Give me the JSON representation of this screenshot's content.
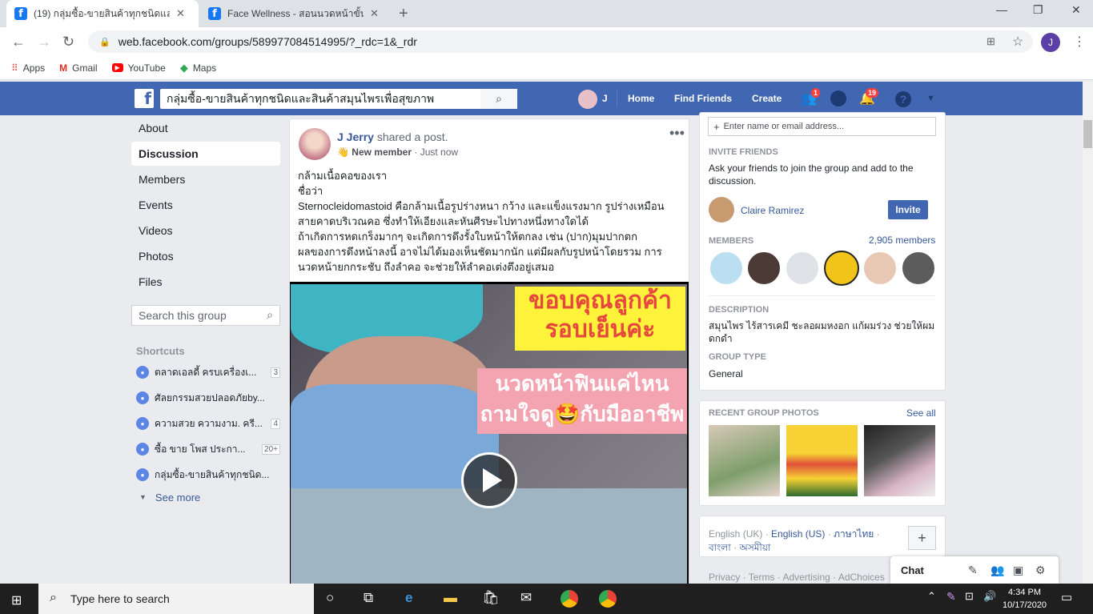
{
  "browser": {
    "tabs": [
      {
        "title": "(19) กลุ่มซื้อ-ขายสินค้าทุกชนิดและสิน"
      },
      {
        "title": "Face Wellness - สอนนวดหน้าขั้นสูงด้"
      }
    ],
    "url": "web.facebook.com/groups/589977084514995/?_rdc=1&_rdr",
    "profile_initial": "J",
    "bookmarks": [
      {
        "label": "Apps",
        "icon": "apps-grid-icon"
      },
      {
        "label": "Gmail",
        "icon": "gmail-icon"
      },
      {
        "label": "YouTube",
        "icon": "youtube-icon"
      },
      {
        "label": "Maps",
        "icon": "maps-icon"
      }
    ]
  },
  "fb": {
    "search_value": "กลุ่มซื้อ-ขายสินค้าทุกชนิดและสินค้าสมุนไพรเพื่อสุขภาพ",
    "profile_name": "J",
    "nav": {
      "home": "Home",
      "find_friends": "Find Friends",
      "create": "Create"
    },
    "badges": {
      "friends": "1",
      "notifications": "19"
    }
  },
  "left_nav": {
    "items": [
      "About",
      "Discussion",
      "Members",
      "Events",
      "Videos",
      "Photos",
      "Files"
    ],
    "selected": "Discussion",
    "search_placeholder": "Search this group",
    "shortcuts_title": "Shortcuts",
    "shortcuts": [
      {
        "name": "ตลาดเอลดี้ ครบเครื่องเ...",
        "count": "3"
      },
      {
        "name": "ศัลยกรรมสวยปลอดภัยby...",
        "count": ""
      },
      {
        "name": "ความสวย ความงาม. ครี...",
        "count": "4"
      },
      {
        "name": "ซื้อ ขาย โพส ประกา...",
        "count": "20+"
      },
      {
        "name": "กลุ่มซื้อ-ขายสินค้าทุกชนิด...",
        "count": ""
      }
    ],
    "see_more": "See more"
  },
  "post": {
    "author": "J Jerry",
    "action": "shared a post.",
    "badge": "New member",
    "time": "Just now",
    "text_lines": [
      "กล้ามเนื้อคอของเรา",
      "ชื่อว่า",
      "Sternocleidomastoid คือกล้ามเนื้อรูปร่างหนา กว้าง และแข็งแรงมาก รูปร่างเหมือน",
      "สายคาดบริเวณคอ ซึ่งทำให้เอียงและหันศีรษะไปทางหนึ่งทางใดได้",
      "ถ้าเกิดการหดเกร็งมากๆ จะเกิดการดึงรั้งใบหน้าให้ตกลง เช่น (ปาก)มุมปากตก",
      "ผลของการดึงหน้าลงนี้ อาจไม่ได้มองเห็นชัดมากนัก แต่มีผลกับรูปหน้าโดยรวม การ",
      "นวดหน้ายกกระชับ ถึงลำคอ จะช่วยให้ลำคอเต่งตึงอยู่เสมอ"
    ],
    "video_caption_1": "ขอบคุณลูกค้า รอบเย็นค่ะ",
    "video_caption_2": "นวดหน้าฟินแค่ไหน ถามใจดู🤩กับมืออาชีพ"
  },
  "right": {
    "add_member_placeholder": "Enter name or email address...",
    "invite_title": "INVITE FRIENDS",
    "invite_text": "Ask your friends to join the group and add to the discussion.",
    "suggested_friend": "Claire Ramirez",
    "invite_button": "Invite",
    "members_title": "MEMBERS",
    "members_count": "2,905 members",
    "description_title": "DESCRIPTION",
    "description": "สมุนไพร ไร้สารเคมี ชะลอผมหงอก แก้ผมร่วง ช่วยให้ผมดกดำ",
    "group_type_title": "GROUP TYPE",
    "group_type": "General",
    "photos_title": "RECENT GROUP PHOTOS",
    "see_all": "See all",
    "languages": [
      "English (UK)",
      "English (US)",
      "ภาษาไทย",
      "বাংলা",
      "অসমীয়া"
    ],
    "footer": "Privacy · Terms · Advertising · AdChoices"
  },
  "chat": {
    "label": "Chat"
  },
  "taskbar": {
    "search_placeholder": "Type here to search",
    "time": "4:34 PM",
    "date": "10/17/2020"
  }
}
